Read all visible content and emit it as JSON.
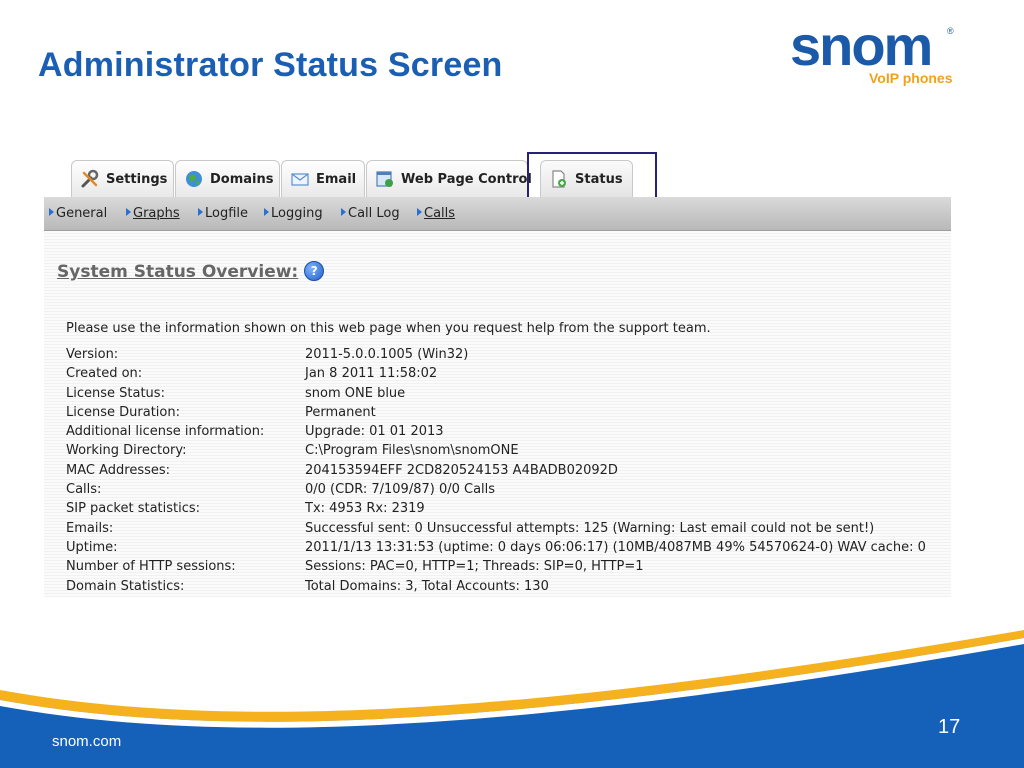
{
  "slide": {
    "title": "Administrator Status Screen",
    "footer_url": "snom.com",
    "page_number": "17",
    "logo": {
      "word": "snom",
      "registered": "®",
      "tagline": "VoIP phones"
    }
  },
  "tabs": [
    {
      "label": "Settings",
      "icon": "wrench-icon"
    },
    {
      "label": "Domains",
      "icon": "globe-icon"
    },
    {
      "label": "Email",
      "icon": "envelope-icon"
    },
    {
      "label": "Web Page Control",
      "icon": "web-page-icon"
    },
    {
      "label": "Status",
      "icon": "status-document-icon",
      "active": true
    }
  ],
  "subnav": [
    {
      "label": "General",
      "underlined": false
    },
    {
      "label": "Graphs",
      "underlined": true
    },
    {
      "label": "Logfile",
      "underlined": false
    },
    {
      "label": "Logging",
      "underlined": false
    },
    {
      "label": "Call Log",
      "underlined": false
    },
    {
      "label": "Calls",
      "underlined": true
    }
  ],
  "status": {
    "title": "System Status Overview:",
    "help_icon": "?",
    "intro": "Please use the information shown on this web page when you request help from the support team.",
    "rows": [
      {
        "label": "Version:",
        "value": "2011-5.0.0.1005 (Win32)"
      },
      {
        "label": "Created on:",
        "value": "Jan 8 2011 11:58:02"
      },
      {
        "label": "License Status:",
        "value": "snom ONE blue"
      },
      {
        "label": "License Duration:",
        "value": "Permanent"
      },
      {
        "label": "Additional license information:",
        "value": "Upgrade: 01 01 2013"
      },
      {
        "label": "Working Directory:",
        "value": "C:\\Program Files\\snom\\snomONE"
      },
      {
        "label": "MAC Addresses:",
        "value": "204153594EFF 2CD820524153 A4BADB02092D"
      },
      {
        "label": "Calls:",
        "value": "0/0 (CDR: 7/109/87) 0/0 Calls"
      },
      {
        "label": "SIP packet statistics:",
        "value": "Tx: 4953 Rx: 2319"
      },
      {
        "label": "Emails:",
        "value": "Successful sent: 0 Unsuccessful attempts: 125 (Warning: Last email could not be sent!)"
      },
      {
        "label": "Uptime:",
        "value": "2011/1/13 13:31:53 (uptime: 0 days 06:06:17) (10MB/4087MB 49% 54570624-0) WAV cache: 0"
      },
      {
        "label": "Number of HTTP sessions:",
        "value": "Sessions: PAC=0, HTTP=1; Threads: SIP=0, HTTP=1"
      },
      {
        "label": "Domain Statistics:",
        "value": "Total Domains: 3, Total Accounts: 130"
      }
    ]
  },
  "colors": {
    "title_blue": "#1a5fb4",
    "logo_blue": "#1b5aa8",
    "logo_orange": "#f0a21c",
    "footer_blue": "#1560b8",
    "highlight_box": "#26217a"
  }
}
